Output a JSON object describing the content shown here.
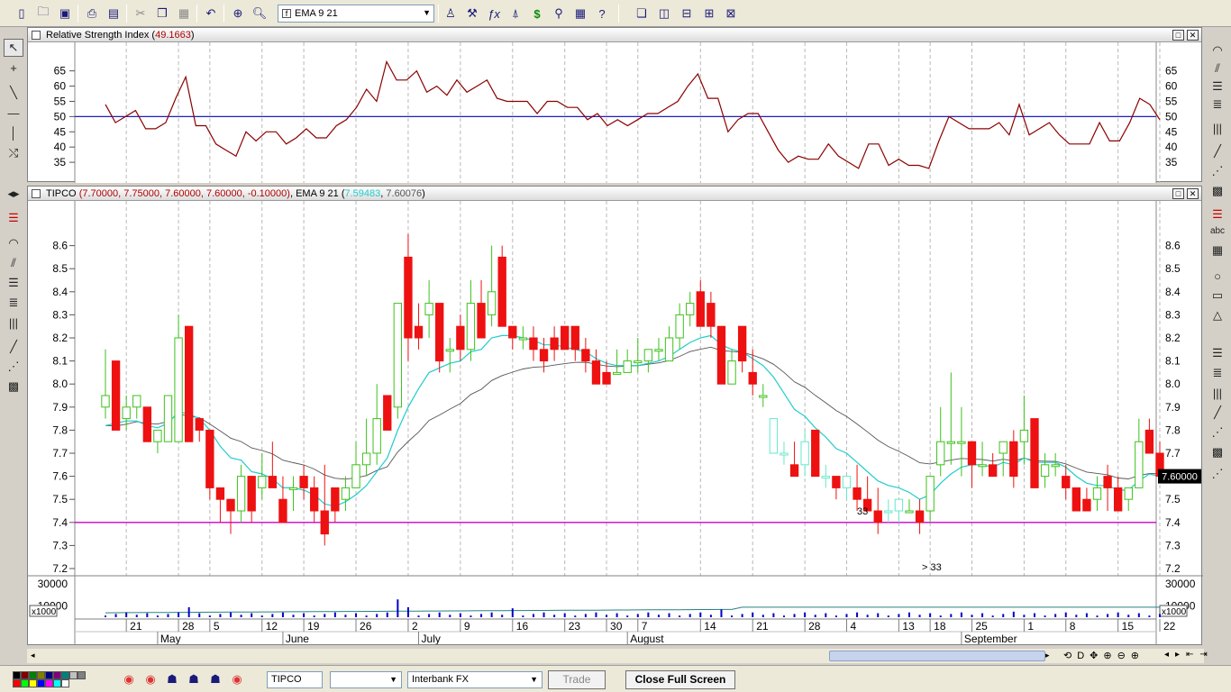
{
  "toolbar": {
    "indicator_select": "EMA 9 21",
    "icons": [
      "new-file-icon",
      "open-folder-icon",
      "save-icon",
      "print-icon",
      "print-preview-icon",
      "cut-icon",
      "copy-icon",
      "paste-icon",
      "undo-icon",
      "crosshair-icon",
      "zoom-icon",
      "indicator-icon",
      "fibonacci-icon",
      "trendline-icon",
      "dollar-icon",
      "binoculars-icon",
      "properties-icon",
      "help-icon",
      "cascade-icon",
      "tile-vertical-icon",
      "tile-horizontal-icon",
      "tile-grid-icon",
      "layout-icon"
    ]
  },
  "rsi_pane": {
    "title_prefix": "Relative Strength Index (",
    "value": "49.1663",
    "title_suffix": ")",
    "y_ticks": [
      "65",
      "60",
      "55",
      "50",
      "45",
      "40",
      "35"
    ],
    "level_line": 50,
    "series": [
      54,
      48,
      50,
      52,
      46,
      46,
      48,
      56,
      63,
      47,
      47,
      41,
      39,
      37,
      45,
      42,
      45,
      45,
      41,
      43,
      46,
      43,
      43,
      47,
      49,
      53,
      59,
      55,
      68,
      62,
      62,
      65,
      58,
      60,
      57,
      62,
      58,
      60,
      62,
      56,
      55,
      55,
      55,
      51,
      55,
      55,
      53,
      53,
      49,
      51,
      47,
      49,
      47,
      49,
      51,
      51,
      53,
      55,
      60,
      64,
      56,
      56,
      45,
      49,
      51,
      51,
      45,
      39,
      35,
      37,
      36,
      36,
      41,
      37,
      35,
      33,
      41,
      41,
      34,
      36,
      34,
      34,
      33,
      42,
      50,
      48,
      46,
      46,
      46,
      48,
      44,
      54,
      44,
      46,
      48,
      44,
      41,
      41,
      41,
      48,
      42,
      42,
      48,
      56,
      54,
      49
    ]
  },
  "price_pane": {
    "symbol": "TIPCO",
    "ohlc_text": "(7.70000, 7.75000, 7.60000, 7.60000, -0.10000)",
    "ema_label": "EMA 9 21",
    "ema_open_paren": "(",
    "ema_fast_value": "7.59483",
    "ema_sep": ", ",
    "ema_slow_value": "7.60076",
    "ema_close_paren": ")",
    "last_price": "7.60000",
    "y_ticks": [
      "8.6",
      "8.5",
      "8.4",
      "8.3",
      "8.2",
      "8.1",
      "8.0",
      "7.9",
      "7.8",
      "7.7",
      "7.6",
      "7.5",
      "7.4",
      "7.3",
      "7.2"
    ],
    "support_line": 7.4,
    "annotations": [
      "33",
      "> 33"
    ],
    "colors": {
      "up": "#3cc21c",
      "down": "#ee1111",
      "ema_fast": "#22cccc",
      "ema_slow": "#555555",
      "support": "#cc00cc",
      "cyan_up": "#66e8cc"
    }
  },
  "volume_pane": {
    "y_ticks": [
      "30000",
      "10000"
    ],
    "multiplier": "x1000"
  },
  "x_axis": {
    "day_labels": [
      "21",
      "28",
      "5",
      "12",
      "19",
      "26",
      "2",
      "9",
      "16",
      "23",
      "30",
      "7",
      "14",
      "21",
      "28",
      "4",
      "13",
      "18",
      "25",
      "1",
      "8",
      "15",
      "22"
    ],
    "month_labels": [
      "May",
      "June",
      "July",
      "August",
      "September"
    ]
  },
  "statusbar": {
    "symbol": "TIPCO",
    "market": "Interbank FX",
    "trade_label": "Trade",
    "close_full_screen": "Close Full Screen"
  },
  "chart_data": {
    "type": "candlestick",
    "title": "TIPCO",
    "ylim": [
      7.2,
      8.7
    ],
    "series_lines": [
      "EMA 9",
      "EMA 21"
    ],
    "ohlc": [
      [
        7.9,
        8.15,
        7.85,
        7.95
      ],
      [
        8.1,
        8.1,
        7.85,
        7.8
      ],
      [
        7.85,
        7.95,
        7.8,
        7.9
      ],
      [
        7.9,
        7.95,
        7.85,
        7.95
      ],
      [
        7.9,
        7.9,
        7.75,
        7.75
      ],
      [
        7.75,
        7.8,
        7.7,
        7.8
      ],
      [
        7.75,
        7.95,
        7.75,
        7.95
      ],
      [
        7.75,
        8.3,
        7.75,
        8.2
      ],
      [
        8.25,
        8.25,
        7.75,
        7.75
      ],
      [
        7.85,
        7.85,
        7.75,
        7.8
      ],
      [
        7.8,
        7.8,
        7.5,
        7.55
      ],
      [
        7.55,
        7.55,
        7.4,
        7.5
      ],
      [
        7.5,
        7.5,
        7.35,
        7.45
      ],
      [
        7.45,
        7.65,
        7.4,
        7.6
      ],
      [
        7.6,
        7.6,
        7.4,
        7.45
      ],
      [
        7.55,
        7.7,
        7.5,
        7.6
      ],
      [
        7.6,
        7.75,
        7.55,
        7.55
      ],
      [
        7.5,
        7.6,
        7.4,
        7.4
      ],
      [
        7.55,
        7.6,
        7.45,
        7.55
      ],
      [
        7.6,
        7.65,
        7.5,
        7.55
      ],
      [
        7.55,
        7.6,
        7.4,
        7.45
      ],
      [
        7.45,
        7.65,
        7.3,
        7.35
      ],
      [
        7.55,
        7.55,
        7.4,
        7.45
      ],
      [
        7.5,
        7.6,
        7.45,
        7.55
      ],
      [
        7.55,
        7.75,
        7.55,
        7.65
      ],
      [
        7.65,
        7.85,
        7.6,
        7.7
      ],
      [
        7.7,
        8.0,
        7.65,
        7.85
      ],
      [
        7.95,
        7.95,
        7.8,
        7.8
      ],
      [
        7.9,
        8.35,
        7.85,
        8.35
      ],
      [
        8.55,
        8.65,
        8.1,
        8.2
      ],
      [
        8.25,
        8.35,
        8.15,
        8.2
      ],
      [
        8.3,
        8.45,
        8.2,
        8.35
      ],
      [
        8.35,
        8.35,
        8.05,
        8.1
      ],
      [
        8.15,
        8.2,
        8.05,
        8.15
      ],
      [
        8.25,
        8.3,
        8.1,
        8.15
      ],
      [
        8.15,
        8.45,
        8.1,
        8.35
      ],
      [
        8.35,
        8.45,
        8.2,
        8.2
      ],
      [
        8.3,
        8.6,
        8.25,
        8.4
      ],
      [
        8.55,
        8.6,
        8.25,
        8.25
      ],
      [
        8.25,
        8.25,
        8.15,
        8.2
      ],
      [
        8.2,
        8.25,
        8.15,
        8.2
      ],
      [
        8.2,
        8.25,
        8.1,
        8.15
      ],
      [
        8.15,
        8.2,
        8.05,
        8.1
      ],
      [
        8.2,
        8.25,
        8.1,
        8.15
      ],
      [
        8.25,
        8.25,
        8.15,
        8.15
      ],
      [
        8.25,
        8.25,
        8.1,
        8.15
      ],
      [
        8.15,
        8.2,
        8.05,
        8.1
      ],
      [
        8.1,
        8.15,
        8.05,
        8.0
      ],
      [
        8.05,
        8.1,
        8.0,
        8.0
      ],
      [
        8.05,
        8.15,
        8.05,
        8.05
      ],
      [
        8.05,
        8.15,
        8.05,
        8.1
      ],
      [
        8.1,
        8.2,
        8.05,
        8.1
      ],
      [
        8.1,
        8.15,
        8.05,
        8.15
      ],
      [
        8.15,
        8.2,
        8.1,
        8.15
      ],
      [
        8.1,
        8.25,
        8.1,
        8.2
      ],
      [
        8.2,
        8.35,
        8.15,
        8.3
      ],
      [
        8.3,
        8.4,
        8.25,
        8.35
      ],
      [
        8.4,
        8.45,
        8.25,
        8.25
      ],
      [
        8.35,
        8.4,
        8.2,
        8.25
      ],
      [
        8.25,
        8.25,
        8.0,
        8.0
      ],
      [
        8.0,
        8.15,
        8.0,
        8.1
      ],
      [
        8.25,
        8.25,
        8.05,
        8.1
      ],
      [
        8.05,
        8.15,
        7.95,
        8.0
      ],
      [
        7.95,
        8.0,
        7.9,
        7.95
      ],
      [
        7.7,
        7.85,
        7.7,
        7.85
      ],
      [
        7.7,
        7.75,
        7.65,
        7.7
      ],
      [
        7.65,
        7.75,
        7.6,
        7.6
      ],
      [
        7.65,
        7.8,
        7.6,
        7.75
      ],
      [
        7.8,
        7.8,
        7.6,
        7.6
      ],
      [
        7.6,
        7.65,
        7.55,
        7.6
      ],
      [
        7.6,
        7.6,
        7.5,
        7.55
      ],
      [
        7.55,
        7.6,
        7.5,
        7.6
      ],
      [
        7.55,
        7.65,
        7.45,
        7.5
      ],
      [
        7.5,
        7.6,
        7.45,
        7.45
      ],
      [
        7.45,
        7.55,
        7.35,
        7.4
      ],
      [
        7.45,
        7.5,
        7.4,
        7.45
      ],
      [
        7.45,
        7.5,
        7.4,
        7.5
      ],
      [
        7.45,
        7.5,
        7.45,
        7.45
      ],
      [
        7.45,
        7.5,
        7.35,
        7.4
      ],
      [
        7.45,
        7.6,
        7.4,
        7.6
      ],
      [
        7.65,
        7.9,
        7.6,
        7.75
      ],
      [
        7.75,
        8.05,
        7.65,
        7.75
      ],
      [
        7.75,
        7.9,
        7.6,
        7.75
      ],
      [
        7.75,
        7.75,
        7.55,
        7.65
      ],
      [
        7.65,
        7.75,
        7.6,
        7.65
      ],
      [
        7.65,
        7.7,
        7.6,
        7.6
      ],
      [
        7.7,
        7.75,
        7.6,
        7.75
      ],
      [
        7.75,
        7.8,
        7.55,
        7.6
      ],
      [
        7.75,
        7.95,
        7.65,
        7.8
      ],
      [
        7.85,
        7.85,
        7.55,
        7.55
      ],
      [
        7.6,
        7.7,
        7.55,
        7.65
      ],
      [
        7.65,
        7.7,
        7.6,
        7.65
      ],
      [
        7.6,
        7.65,
        7.5,
        7.55
      ],
      [
        7.55,
        7.55,
        7.45,
        7.45
      ],
      [
        7.5,
        7.55,
        7.45,
        7.45
      ],
      [
        7.5,
        7.6,
        7.45,
        7.55
      ],
      [
        7.6,
        7.65,
        7.45,
        7.55
      ],
      [
        7.55,
        7.6,
        7.45,
        7.45
      ],
      [
        7.5,
        7.55,
        7.45,
        7.55
      ],
      [
        7.55,
        7.85,
        7.55,
        7.75
      ],
      [
        7.8,
        7.85,
        7.7,
        7.7
      ],
      [
        7.7,
        7.75,
        7.6,
        7.6
      ]
    ],
    "ema_fast": [
      7.82,
      7.83,
      7.84,
      7.84,
      7.82,
      7.81,
      7.83,
      7.88,
      7.87,
      7.85,
      7.8,
      7.73,
      7.68,
      7.67,
      7.62,
      7.61,
      7.59,
      7.55,
      7.55,
      7.54,
      7.52,
      7.48,
      7.47,
      7.49,
      7.52,
      7.56,
      7.62,
      7.68,
      7.8,
      7.9,
      7.98,
      8.05,
      8.07,
      8.09,
      8.1,
      8.14,
      8.15,
      8.2,
      8.21,
      8.21,
      8.2,
      8.19,
      8.17,
      8.17,
      8.16,
      8.15,
      8.14,
      8.11,
      8.09,
      8.08,
      8.08,
      8.08,
      8.09,
      8.1,
      8.12,
      8.15,
      8.18,
      8.2,
      8.21,
      8.17,
      8.15,
      8.14,
      8.11,
      8.08,
      8.03,
      7.96,
      7.89,
      7.86,
      7.81,
      7.77,
      7.72,
      7.7,
      7.66,
      7.62,
      7.58,
      7.56,
      7.55,
      7.53,
      7.5,
      7.52,
      7.57,
      7.61,
      7.64,
      7.65,
      7.65,
      7.64,
      7.66,
      7.65,
      7.68,
      7.66,
      7.66,
      7.66,
      7.64,
      7.6,
      7.57,
      7.56,
      7.56,
      7.54,
      7.54,
      7.58,
      7.61,
      7.6
    ]
  }
}
